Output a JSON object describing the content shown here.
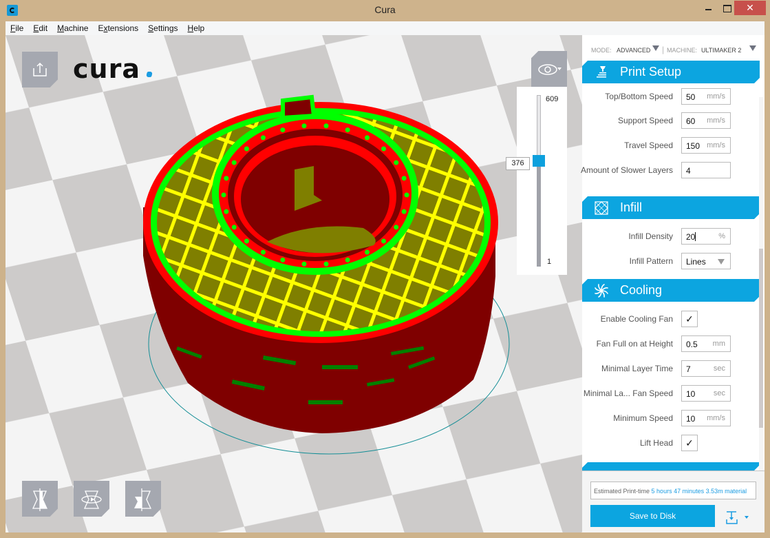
{
  "window": {
    "title": "Cura",
    "controls": {
      "minimize": "minimize",
      "maximize": "maximize",
      "close": "✕"
    }
  },
  "menu": [
    {
      "label": "File",
      "key": "F",
      "rest": "ile"
    },
    {
      "label": "Edit",
      "key": "E",
      "rest": "dit"
    },
    {
      "label": "Machine",
      "key": "M",
      "rest": "achine"
    },
    {
      "label": "Extensions",
      "pre": "E",
      "key": "x",
      "rest": "tensions"
    },
    {
      "label": "Settings",
      "key": "S",
      "rest": "ettings"
    },
    {
      "label": "Help",
      "key": "H",
      "rest": "elp"
    }
  ],
  "viewport": {
    "logo": "cura",
    "open_file_icon": "open-file-icon",
    "view_mode_icon": "eye-icon",
    "layer_slider": {
      "max": "609",
      "min": "1",
      "current": "376",
      "fraction": 0.617
    },
    "tools": [
      {
        "name": "scale-tool",
        "icon": "scale-icon"
      },
      {
        "name": "rotate-tool",
        "icon": "rotate-icon"
      },
      {
        "name": "mirror-tool",
        "icon": "mirror-icon"
      }
    ],
    "colors": {
      "wall_outer": "#ff0000",
      "wall_dark": "#7f0000",
      "wall_inner": "#00ff00",
      "infill": "#ffff00",
      "skin": "#7f7f00",
      "build_outline": "#148e96"
    }
  },
  "sidebar": {
    "mode_label": "MODE:",
    "mode_value": "ADVANCED",
    "machine_label": "MACHINE:",
    "machine_value": "ULTIMAKER 2",
    "sections": {
      "print_setup": {
        "title": "Print Setup",
        "icon": "print-setup-icon"
      },
      "infill": {
        "title": "Infill",
        "icon": "infill-icon"
      },
      "cooling": {
        "title": "Cooling",
        "icon": "cooling-fan-icon"
      }
    },
    "speed_settings": [
      {
        "label": "Top/Bottom Speed",
        "value": "50",
        "unit": "mm/s"
      },
      {
        "label": "Support Speed",
        "value": "60",
        "unit": "mm/s"
      },
      {
        "label": "Travel Speed",
        "value": "150",
        "unit": "mm/s"
      },
      {
        "label": "Amount of Slower Layers",
        "value": "4",
        "unit": ""
      }
    ],
    "infill_settings": {
      "density": {
        "label": "Infill Density",
        "value": "20",
        "unit": "%"
      },
      "pattern": {
        "label": "Infill Pattern",
        "value": "Lines"
      }
    },
    "cooling_settings": [
      {
        "label": "Enable Cooling Fan",
        "type": "check",
        "value": "✓"
      },
      {
        "label": "Fan Full on at Height",
        "type": "field",
        "value": "0.5",
        "unit": "mm"
      },
      {
        "label": "Minimal Layer Time",
        "type": "field",
        "value": "7",
        "unit": "sec"
      },
      {
        "label": "Minimal La... Fan Speed",
        "type": "field",
        "value": "10",
        "unit": "sec"
      },
      {
        "label": "Minimum Speed",
        "type": "field",
        "value": "10",
        "unit": "mm/s"
      },
      {
        "label": "Lift Head",
        "type": "check",
        "value": "✓"
      }
    ],
    "estimate": {
      "label": "Estimated Print-time",
      "time": "5 hours 47 minutes",
      "material": "3.53m material"
    },
    "save_button": "Save to Disk",
    "output_device_icon": "output-device-icon"
  }
}
